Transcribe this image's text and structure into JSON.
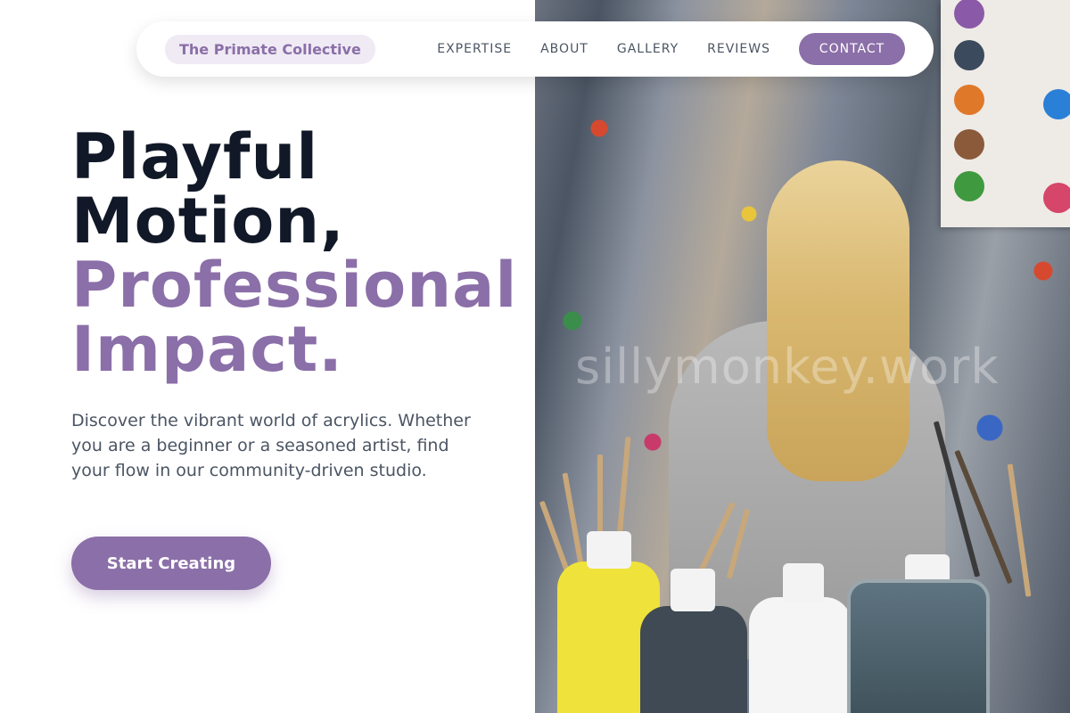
{
  "nav": {
    "brand": "The Primate Collective",
    "links": [
      "EXPERTISE",
      "ABOUT",
      "GALLERY",
      "REVIEWS"
    ],
    "contact": "CONTACT"
  },
  "hero": {
    "line1": "Playful",
    "line2": "Motion,",
    "line3": "Professional",
    "line4": "Impact.",
    "description": "Discover the vibrant world of acrylics. Whether you are a beginner or a seasoned artist, find your flow in our community-driven studio.",
    "cta": "Start Creating"
  },
  "image": {
    "watermark": "sillymonkey.work"
  },
  "colors": {
    "accent": "#8b6fa8",
    "heading": "#111827",
    "body_text": "#4b5563",
    "brand_pill_bg": "#efeaf4"
  }
}
